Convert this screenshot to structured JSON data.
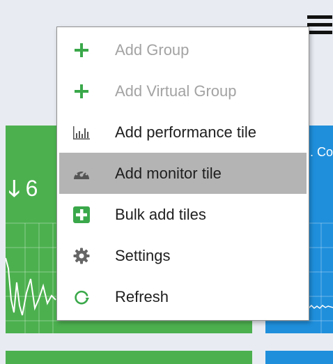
{
  "colors": {
    "page_background": "#e8ecf2",
    "tile_green": "#4cb04f",
    "tile_blue": "#1f8fdc",
    "menu_highlight": "#b4b4b4",
    "menu_icon_green": "#3aa84a",
    "menu_icon_grey": "#555555",
    "disabled_text": "#a3a3a3"
  },
  "tiles": {
    "green_value_partial": "6",
    "blue_title_partial": ". Co"
  },
  "menu": {
    "items": [
      {
        "label": "Add Group",
        "icon": "plus-icon",
        "enabled": false
      },
      {
        "label": "Add Virtual Group",
        "icon": "plus-icon",
        "enabled": false
      },
      {
        "label": "Add performance tile",
        "icon": "bar-chart-icon",
        "enabled": true
      },
      {
        "label": "Add monitor tile",
        "icon": "gauge-icon",
        "enabled": true,
        "highlighted": true
      },
      {
        "label": "Bulk add tiles",
        "icon": "plus-square-icon",
        "enabled": true
      },
      {
        "label": "Settings",
        "icon": "gear-icon",
        "enabled": true
      },
      {
        "label": "Refresh",
        "icon": "refresh-icon",
        "enabled": true
      }
    ]
  }
}
